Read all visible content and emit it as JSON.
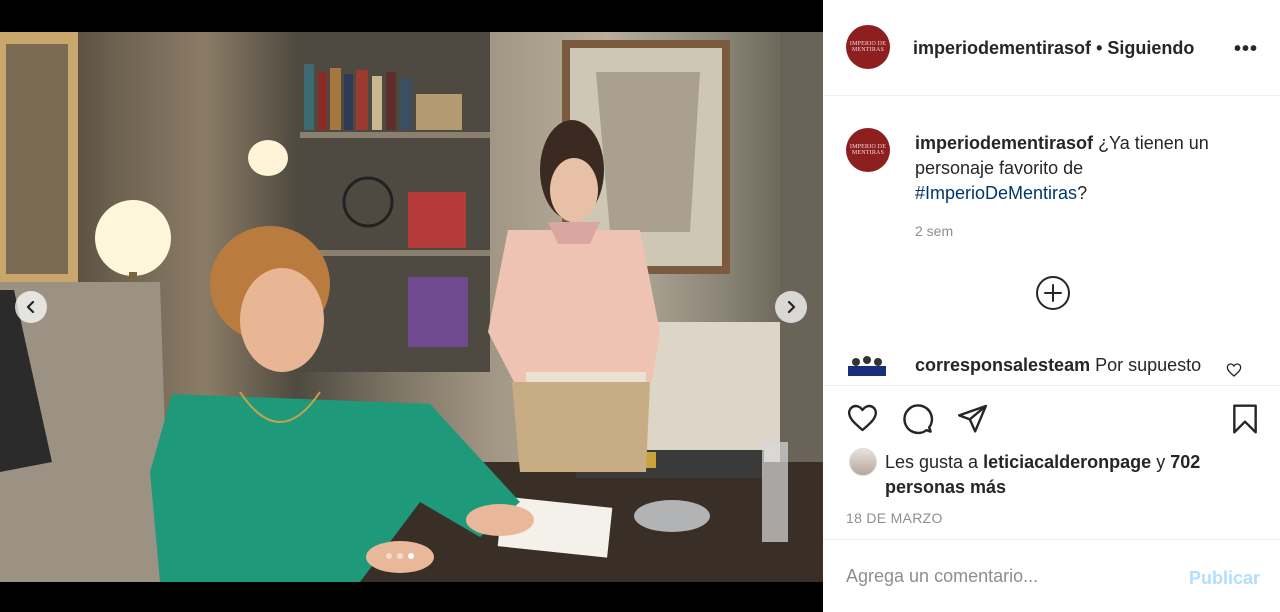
{
  "post": {
    "username": "imperiodementirasof",
    "separator": "•",
    "follow_status": "Siguiendo",
    "more_icon": "more-options-icon",
    "avatar_text": "IMPERIO DE MENTIRAS"
  },
  "caption": {
    "username": "imperiodementirasof",
    "text": "¿Ya tienen un personaje favorito de",
    "hashtag": "#ImperioDeMentiras",
    "hashtag_suffix": "?",
    "time": "2 sem",
    "load_more_icon": "plus-circle-icon"
  },
  "comment": {
    "username": "corresponsalesteam",
    "text": "Por supuesto"
  },
  "likes": {
    "prefix": "Les gusta a",
    "user": "leticiacalderonpage",
    "conjunction": "y",
    "others": "702 personas más"
  },
  "date": "18 DE MARZO",
  "add_comment": {
    "placeholder": "Agrega un comentario...",
    "publish_label": "Publicar"
  },
  "carousel": {
    "slides": 3,
    "active_slide": 3
  },
  "colors": {
    "link": "#00376b",
    "publish_disabled": "#b2dffc",
    "avatar_brand": "#8e1f1f",
    "secondary_text": "#8e8e8e"
  }
}
